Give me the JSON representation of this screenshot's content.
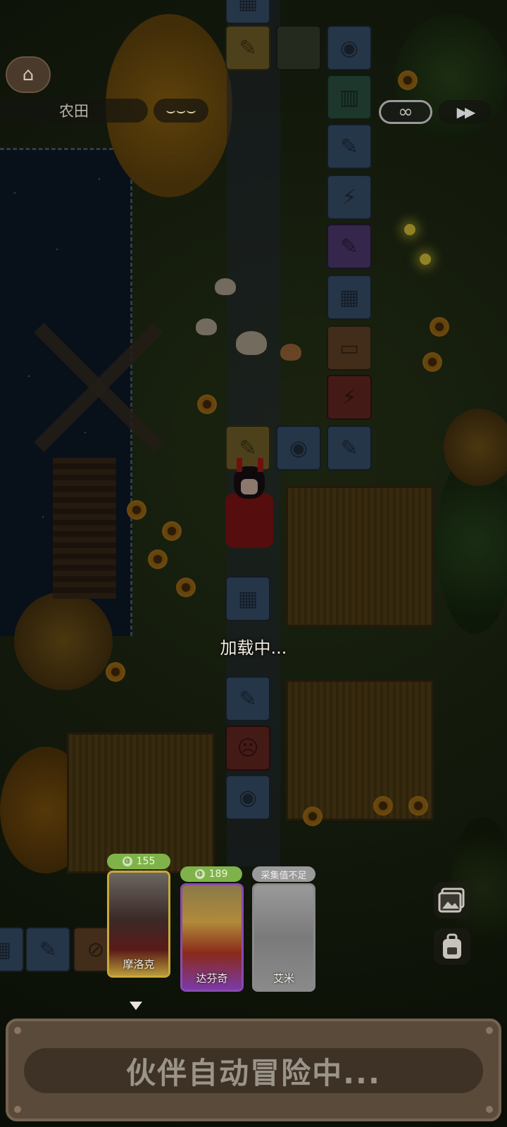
{
  "header": {
    "home_icon": "home-icon",
    "location": "农田",
    "sleep_icon": "closed-eye-icon",
    "loop_icon": "infinity-icon",
    "speed_icon": "fast-forward-icon"
  },
  "status": {
    "loading_text": "加载中..."
  },
  "companions": [
    {
      "name": "摩洛克",
      "badge": "155",
      "badge_icon": "coin-icon",
      "selected": true,
      "frame_color": "#c8a83a"
    },
    {
      "name": "达芬奇",
      "badge": "189",
      "badge_icon": "coin-icon",
      "selected": false,
      "frame_color": "#8a4ab0"
    },
    {
      "name": "艾米",
      "badge": "采集值不足",
      "selected": false,
      "frame_color": "#8a8a8a"
    }
  ],
  "side_buttons": {
    "album_icon": "gallery-icon",
    "bag_icon": "backpack-icon"
  },
  "bottom": {
    "auto_label": "伙伴自动冒险中..."
  },
  "colors": {
    "panel": "#5a4a3a",
    "panel_border": "#756251",
    "badge_green": "#7fb34a",
    "badge_gray": "#9a9a9a"
  }
}
